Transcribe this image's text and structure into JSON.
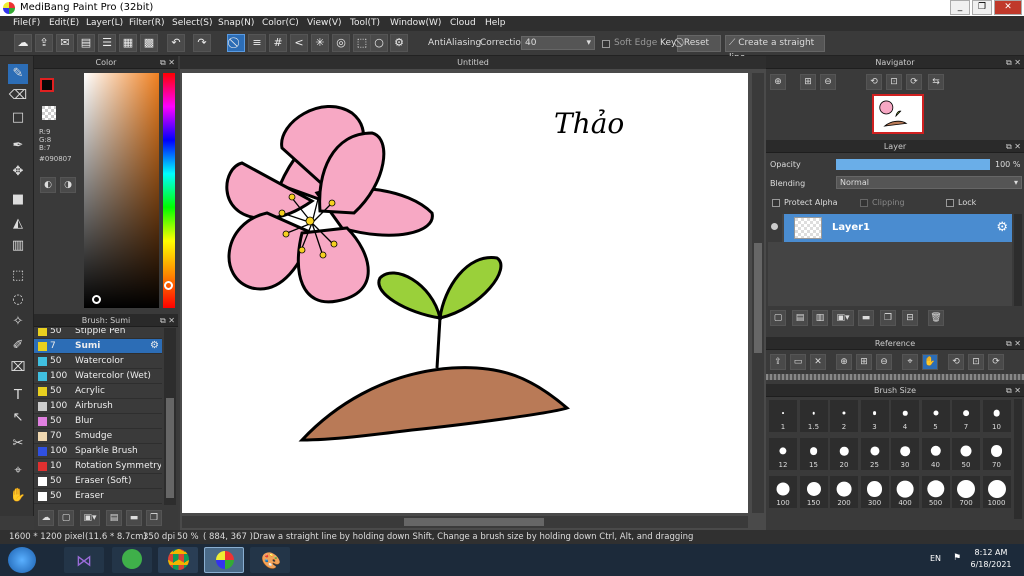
{
  "window": {
    "title": "MediBang Paint Pro (32bit)",
    "minimize": "_",
    "restore": "❐",
    "close": "✕"
  },
  "menu": [
    "File(F)",
    "Edit(E)",
    "Layer(L)",
    "Filter(R)",
    "Select(S)",
    "Snap(N)",
    "Color(C)",
    "View(V)",
    "Tool(T)",
    "Window(W)",
    "Cloud",
    "Help"
  ],
  "toolbar": {
    "antialiasing_label": "AntiAliasing",
    "correction_label": "Correction",
    "correction_value": "40",
    "softedge_label": "Soft Edge",
    "key_label": "Key",
    "reset_label": "Reset",
    "straight_line_label": "Create a straight line"
  },
  "color_panel": {
    "title": "Color",
    "r": "R:9",
    "g": "G:8",
    "b": "B:7",
    "hex": "#090807",
    "primary_color": "#090807"
  },
  "brush_panel": {
    "title": "Brush: Sumi",
    "items": [
      {
        "size": "50",
        "name": "Stipple Pen",
        "color": "#e8d020"
      },
      {
        "size": "7",
        "name": "Sumi",
        "color": "#e8d020",
        "selected": true
      },
      {
        "size": "50",
        "name": "Watercolor",
        "color": "#40c0e0"
      },
      {
        "size": "100",
        "name": "Watercolor (Wet)",
        "color": "#40c0e0"
      },
      {
        "size": "50",
        "name": "Acrylic",
        "color": "#e8d020"
      },
      {
        "size": "100",
        "name": "Airbrush",
        "color": "#cccccc"
      },
      {
        "size": "50",
        "name": "Blur",
        "color": "#e080e0"
      },
      {
        "size": "70",
        "name": "Smudge",
        "color": "#f0d8b0"
      },
      {
        "size": "100",
        "name": "Sparkle Brush",
        "color": "#3050e0"
      },
      {
        "size": "10",
        "name": "Rotation Symmetry P",
        "color": "#e03030"
      },
      {
        "size": "50",
        "name": "Eraser (Soft)",
        "color": "#ffffff"
      },
      {
        "size": "50",
        "name": "Eraser",
        "color": "#ffffff"
      }
    ]
  },
  "canvas": {
    "tab_title": "Untitled",
    "signature": "Thảo"
  },
  "navigator": {
    "title": "Navigator"
  },
  "layer_panel": {
    "title": "Layer",
    "opacity_label": "Opacity",
    "opacity_value": "100 %",
    "opacity_fraction": 1.0,
    "blending_label": "Blending",
    "blending_value": "Normal",
    "protect_alpha": "Protect Alpha",
    "clipping": "Clipping",
    "lock": "Lock",
    "layers": [
      {
        "name": "Layer1"
      }
    ]
  },
  "reference": {
    "title": "Reference"
  },
  "brush_size": {
    "title": "Brush Size",
    "sizes": [
      "1",
      "1.5",
      "2",
      "3",
      "4",
      "5",
      "7",
      "10",
      "12",
      "15",
      "20",
      "25",
      "30",
      "40",
      "50",
      "70",
      "100",
      "150",
      "200",
      "300",
      "400",
      "500",
      "700",
      "1000"
    ]
  },
  "status": {
    "dimensions": "1600 * 1200 pixel",
    "physical": "(11.6 * 8.7cm)",
    "dpi": "350 dpi",
    "zoom": "50 %",
    "coords": "( 884, 367 )",
    "hint": "Draw a straight line by holding down Shift, Change a brush size by holding down Ctrl, Alt, and dragging"
  },
  "taskbar": {
    "lang": "EN",
    "time": "8:12 AM",
    "date": "6/18/2021"
  }
}
